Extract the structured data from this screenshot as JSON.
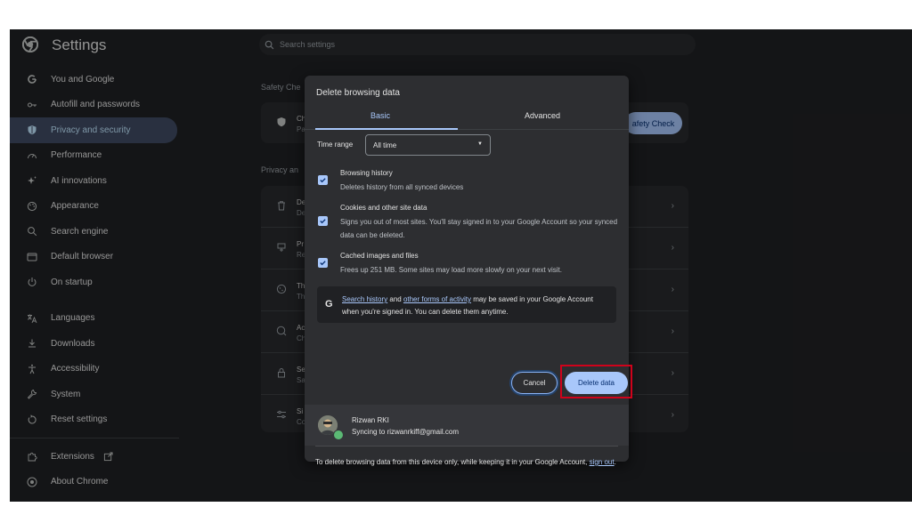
{
  "app": {
    "title": "Settings"
  },
  "search": {
    "placeholder": "Search settings"
  },
  "sidebar": {
    "items": [
      {
        "label": "You and Google",
        "icon": "google-g-icon"
      },
      {
        "label": "Autofill and passwords",
        "icon": "key-icon"
      },
      {
        "label": "Privacy and security",
        "icon": "shield-icon",
        "active": true
      },
      {
        "label": "Performance",
        "icon": "speedometer-icon"
      },
      {
        "label": "AI innovations",
        "icon": "sparkle-icon"
      },
      {
        "label": "Appearance",
        "icon": "palette-icon"
      },
      {
        "label": "Search engine",
        "icon": "search-icon"
      },
      {
        "label": "Default browser",
        "icon": "browser-window-icon"
      },
      {
        "label": "On startup",
        "icon": "power-icon"
      },
      {
        "label": "Languages",
        "icon": "translate-icon"
      },
      {
        "label": "Downloads",
        "icon": "download-icon"
      },
      {
        "label": "Accessibility",
        "icon": "accessibility-icon"
      },
      {
        "label": "System",
        "icon": "wrench-icon"
      },
      {
        "label": "Reset settings",
        "icon": "reset-icon"
      },
      {
        "label": "Extensions",
        "icon": "puzzle-icon"
      },
      {
        "label": "About Chrome",
        "icon": "chrome-icon"
      }
    ]
  },
  "background": {
    "safety_label": "Safety Che",
    "safety_title": "Ch",
    "safety_sub": "Pa",
    "safety_button": "afety Check",
    "privacy_label": "Privacy an",
    "rows": [
      {
        "t": "De",
        "s": "De"
      },
      {
        "t": "Pr",
        "s": "Re"
      },
      {
        "t": "Th",
        "s": "Th"
      },
      {
        "t": "Ac",
        "s": "Ch"
      },
      {
        "t": "Se",
        "s": "Sa"
      },
      {
        "t": "Si",
        "s": "Co"
      }
    ]
  },
  "dialog": {
    "title": "Delete browsing data",
    "tabs": {
      "basic": "Basic",
      "advanced": "Advanced"
    },
    "time_range": {
      "label": "Time range",
      "value": "All time"
    },
    "options": [
      {
        "title": "Browsing history",
        "desc": "Deletes history from all synced devices",
        "checked": true
      },
      {
        "title": "Cookies and other site data",
        "desc": "Signs you out of most sites. You'll stay signed in to your Google Account so your synced data can be deleted.",
        "checked": true
      },
      {
        "title": "Cached images and files",
        "desc": "Frees up 251 MB. Some sites may load more slowly on your next visit.",
        "checked": true
      }
    ],
    "info": {
      "link1": "Search history",
      "mid": " and ",
      "link2": "other forms of activity",
      "rest": " may be saved in your Google Account when you're signed in. You can delete them anytime."
    },
    "cancel_label": "Cancel",
    "delete_label": "Delete data",
    "account": {
      "name": "Rizwan RKI",
      "sync": "Syncing to rizwanrkiff@gmail.com"
    },
    "footer": {
      "text": "To delete browsing data from this device only, while keeping it in your Google Account, ",
      "link": "sign out",
      "end": "."
    }
  },
  "colors": {
    "accent": "#a8c7fa",
    "highlight": "#d0021b",
    "bg": "#202124"
  }
}
